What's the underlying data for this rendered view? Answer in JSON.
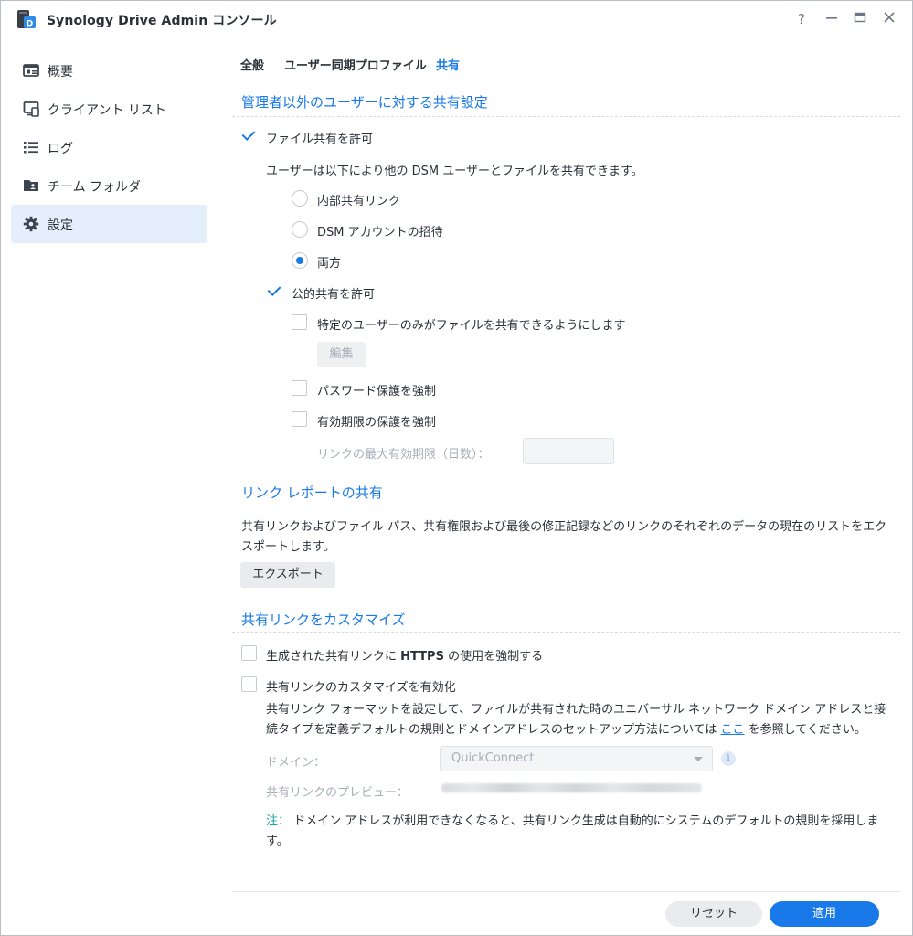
{
  "window": {
    "title": "Synology Drive Admin コンソール",
    "controls": {
      "help": "?",
      "minimize": "—",
      "maximize": "▭",
      "close": "✕"
    }
  },
  "sidebar": {
    "items": [
      {
        "label": "概要",
        "icon": "overview-icon",
        "active": false
      },
      {
        "label": "クライアント リスト",
        "icon": "client-list-icon",
        "active": false
      },
      {
        "label": "ログ",
        "icon": "log-icon",
        "active": false
      },
      {
        "label": "チーム フォルダ",
        "icon": "team-folder-icon",
        "active": false
      },
      {
        "label": "設定",
        "icon": "gear-icon",
        "active": true
      }
    ]
  },
  "tabs": [
    {
      "label": "全般",
      "active": false
    },
    {
      "label": "ユーザー同期プロファイル",
      "active": false
    },
    {
      "label": "共有",
      "active": true
    }
  ],
  "sharing": {
    "title": "管理者以外のユーザーに対する共有設定",
    "allow_file_sharing": {
      "label": "ファイル共有を許可",
      "checked": true
    },
    "description": "ユーザーは以下により他の DSM ユーザーとファイルを共有できます。",
    "options": [
      {
        "label": "内部共有リンク",
        "selected": false
      },
      {
        "label": "DSM アカウントの招待",
        "selected": false
      },
      {
        "label": "両方",
        "selected": true
      }
    ],
    "allow_public_sharing": {
      "label": "公的共有を許可",
      "checked": true
    },
    "specific_users_only": {
      "label": "特定のユーザーのみがファイルを共有できるようにします",
      "checked": false
    },
    "edit_button": "編集",
    "enforce_password": {
      "label": "パスワード保護を強制",
      "checked": false
    },
    "enforce_expiry": {
      "label": "有効期限の保護を強制",
      "checked": false
    },
    "max_days_label": "リンクの最大有効期限（日数）：",
    "max_days_value": ""
  },
  "link_report": {
    "title": "リンク レポートの共有",
    "description_line1": "共有リンクおよびファイル パス、共有権限および最後の修正記録などのリンクのそれぞれのデータの現在のリストをエク",
    "description_line2": "スポートします。",
    "export_button": "エクスポート"
  },
  "customize": {
    "title": "共有リンクをカスタマイズ",
    "force_https": {
      "label_before": "生成された共有リンクに ",
      "label_bold": "HTTPS",
      "label_after": " の使用を強制する",
      "checked": false
    },
    "enable_customize": {
      "label": "共有リンクのカスタマイズを有効化",
      "checked": false
    },
    "desc_line1": "共有リンク フォーマットを設定して、ファイルが共有された時のユニバーサル ネットワーク ドメイン アドレスと接",
    "desc_line2_before": "続タイプを定義デフォルトの規則とドメインアドレスのセットアップ方法については ",
    "desc_link": "ここ",
    "desc_line2_after": " を参照してください。",
    "domain_label": "ドメイン：",
    "domain_value": "QuickConnect",
    "preview_label": "共有リンクのプレビュー：",
    "note_label": "注：",
    "note_line1": " ドメイン アドレスが利用できなくなると、共有リンク生成は自動的にシステムのデフォルトの規則を採用しま",
    "note_line2": "す。"
  },
  "footer": {
    "reset": "リセット",
    "apply": "適用"
  },
  "colors": {
    "accent": "#1a79e8",
    "active_nav_bg": "#e5eefb",
    "note": "#19a39e"
  }
}
